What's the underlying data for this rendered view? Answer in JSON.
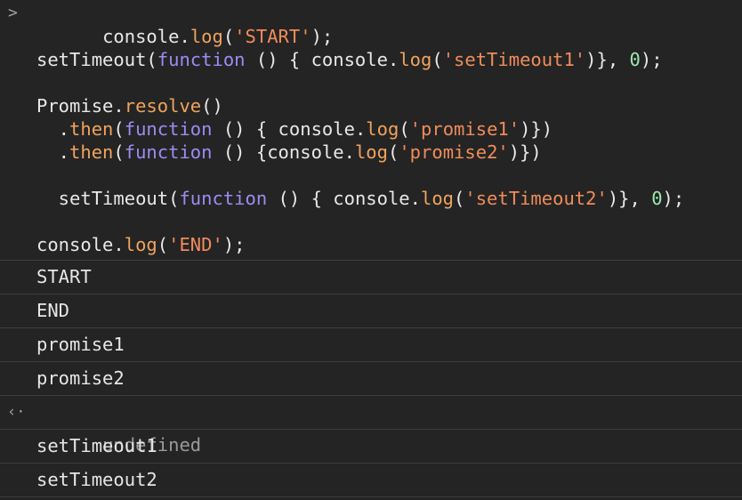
{
  "console": {
    "prompt_icon": "chevron-right-icon",
    "input": {
      "l1": {
        "a": "console.",
        "b": "log",
        "c": "(",
        "d": "'START'",
        "e": ");"
      },
      "l2": {
        "a": "setTimeout",
        "b": "(",
        "c": "function",
        "d": " () { console.",
        "e": "log",
        "f": "(",
        "g": "'setTimeout1'",
        "h": ")}, ",
        "i": "0",
        "j": ");"
      },
      "l3": {
        "a": "Promise.",
        "b": "resolve",
        "c": "()"
      },
      "l4": {
        "a": "  .",
        "b": "then",
        "c": "(",
        "d": "function",
        "e": " () { console.",
        "f": "log",
        "g": "(",
        "h": "'promise1'",
        "i": ")})"
      },
      "l5": {
        "a": "  .",
        "b": "then",
        "c": "(",
        "d": "function",
        "e": " () {console.",
        "f": "log",
        "g": "(",
        "h": "'promise2'",
        "i": ")})"
      },
      "l6": {
        "a": "  setTimeout",
        "b": "(",
        "c": "function",
        "d": " () { console.",
        "e": "log",
        "f": "(",
        "g": "'setTimeout2'",
        "h": ")}, ",
        "i": "0",
        "j": ");"
      },
      "l7": {
        "a": "console.",
        "b": "log",
        "c": "(",
        "d": "'END'",
        "e": ");"
      }
    },
    "output": [
      "START",
      "END",
      "promise1",
      "promise2"
    ],
    "return_value": "undefined",
    "return_icon": "return-arrow-icon",
    "output_after": [
      "setTimeout1",
      "setTimeout2"
    ]
  }
}
